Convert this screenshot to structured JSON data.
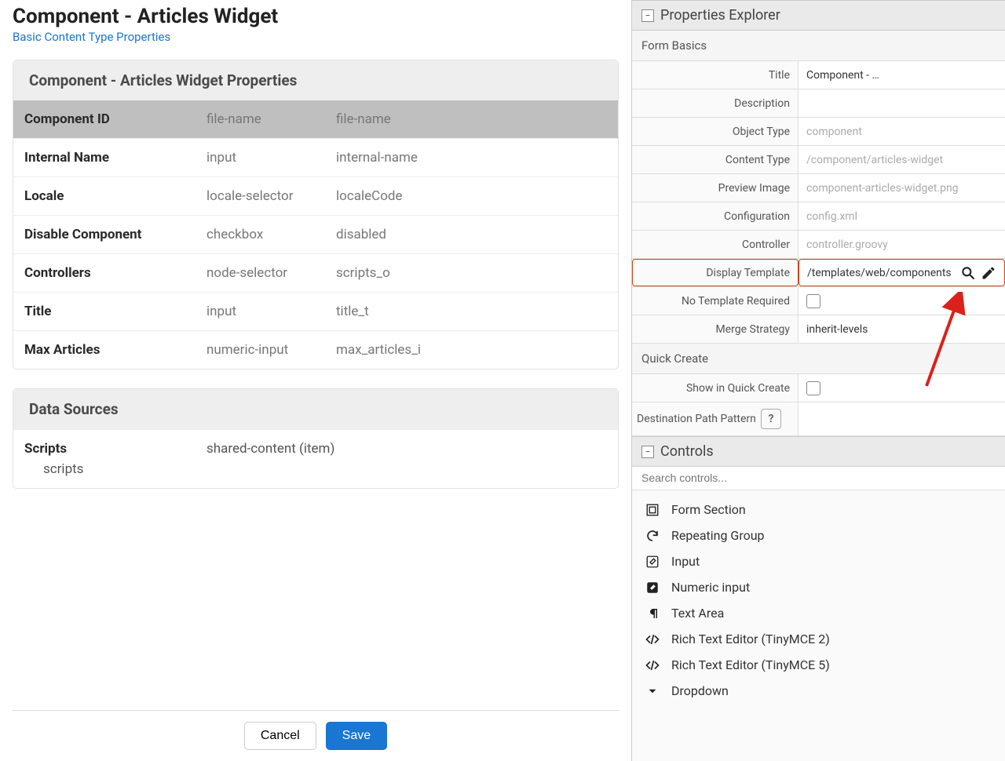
{
  "header": {
    "title": "Component - Articles Widget",
    "breadcrumb": "Basic Content Type Properties"
  },
  "propsPanel": {
    "title": "Component - Articles Widget Properties",
    "rows": [
      {
        "name": "Component ID",
        "type": "file-name",
        "var": "file-name",
        "selected": true
      },
      {
        "name": "Internal Name",
        "type": "input",
        "var": "internal-name"
      },
      {
        "name": "Locale",
        "type": "locale-selector",
        "var": "localeCode"
      },
      {
        "name": "Disable Component",
        "type": "checkbox",
        "var": "disabled"
      },
      {
        "name": "Controllers",
        "type": "node-selector",
        "var": "scripts_o"
      },
      {
        "name": "Title",
        "type": "input",
        "var": "title_t"
      },
      {
        "name": "Max Articles",
        "type": "numeric-input",
        "var": "max_articles_i"
      }
    ]
  },
  "dataSources": {
    "title": "Data Sources",
    "items": [
      {
        "label": "Scripts",
        "sub": "scripts",
        "value": "shared-content (item)"
      }
    ]
  },
  "footer": {
    "cancel": "Cancel",
    "save": "Save"
  },
  "explorer": {
    "title": "Properties Explorer",
    "formBasics": "Form Basics",
    "fields": {
      "title_label": "Title",
      "title_value": "Component - …",
      "description_label": "Description",
      "description_value": "",
      "objectType_label": "Object Type",
      "objectType_placeholder": "component",
      "contentType_label": "Content Type",
      "contentType_placeholder": "/component/articles-widget",
      "previewImage_label": "Preview Image",
      "previewImage_placeholder": "component-articles-widget.png",
      "configuration_label": "Configuration",
      "configuration_placeholder": "config.xml",
      "controller_label": "Controller",
      "controller_placeholder": "controller.groovy",
      "displayTemplate_label": "Display Template",
      "displayTemplate_value": "/templates/web/components",
      "noTemplate_label": "No Template Required",
      "mergeStrategy_label": "Merge Strategy",
      "mergeStrategy_value": "inherit-levels"
    },
    "quickCreate": "Quick Create",
    "quickFields": {
      "showQuickCreate_label": "Show in Quick Create",
      "destPattern_label": "Destination Path Pattern"
    },
    "controls": "Controls",
    "searchPlaceholder": "Search controls...",
    "controlItems": [
      {
        "name": "Form Section",
        "icon": "section"
      },
      {
        "name": "Repeating Group",
        "icon": "refresh"
      },
      {
        "name": "Input",
        "icon": "edit"
      },
      {
        "name": "Numeric input",
        "icon": "pencil-box"
      },
      {
        "name": "Text Area",
        "icon": "paragraph"
      },
      {
        "name": "Rich Text Editor (TinyMCE 2)",
        "icon": "code"
      },
      {
        "name": "Rich Text Editor (TinyMCE 5)",
        "icon": "code"
      },
      {
        "name": "Dropdown",
        "icon": "caret"
      }
    ]
  }
}
